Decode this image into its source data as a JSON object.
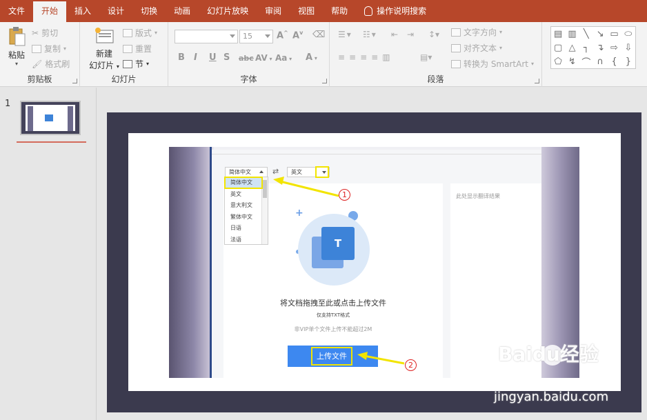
{
  "ribbon_tabs": [
    "文件",
    "开始",
    "插入",
    "设计",
    "切换",
    "动画",
    "幻灯片放映",
    "审阅",
    "视图",
    "帮助"
  ],
  "active_tab": "开始",
  "tell_me": "操作说明搜索",
  "clipboard": {
    "paste": "粘贴",
    "cut": "剪切",
    "copy": "复制",
    "format_painter": "格式刷",
    "label": "剪贴板"
  },
  "slides_group": {
    "new_slide_line1": "新建",
    "new_slide_line2": "幻灯片",
    "layout": "版式",
    "reset": "重置",
    "section": "节",
    "label": "幻灯片"
  },
  "font_group": {
    "font_name": "",
    "font_size": "15",
    "bold": "B",
    "italic": "I",
    "underline": "U",
    "shadow": "S",
    "strikethrough": "abc",
    "spacing": "AV",
    "change_case": "Aa",
    "font_color": "A",
    "label": "字体"
  },
  "paragraph_group": {
    "text_direction": "文字方向",
    "align_text": "对齐文本",
    "smartart": "转换为 SmartArt",
    "label": "段落"
  },
  "thumbnails": {
    "slide_number": "1"
  },
  "embedded_ui": {
    "source_lang": "简体中文",
    "target_lang": "英文",
    "lang_options": [
      "简体中文",
      "英文",
      "意大利文",
      "繁体中文",
      "日语",
      "法语"
    ],
    "result_placeholder": "此处显示翻译结果",
    "icon_letter": "T",
    "drop_title": "将文档拖拽至此或点击上传文件",
    "drop_sub": "仅支持TXT格式",
    "drop_note": "非VIP单个文件上传不能超过2M",
    "upload_button": "上传文件"
  },
  "annotations": {
    "marker1": "1",
    "marker2": "2",
    "highlight_color": "#f2e400",
    "arrow_color": "#f2e400"
  },
  "watermark": {
    "brand": "Baidu经验",
    "url": "jingyan.baidu.com"
  },
  "colors": {
    "ribbon": "#b7472a",
    "primary_blue": "#3d88f0",
    "slide_frame": "#3b3a4e"
  }
}
